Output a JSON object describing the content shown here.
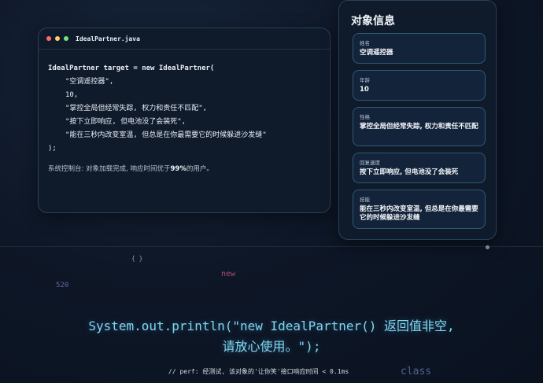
{
  "code_window": {
    "filename": "IdealPartner.java",
    "code_lines": {
      "head": "IdealPartner target = new IdealPartner(",
      "arg1": "\"空调遥控器\",",
      "arg2": "10,",
      "arg3": "\"掌控全局但经常失踪, 权力和责任不匹配\",",
      "arg4": "\"按下立即响应, 但电池没了会装死\",",
      "arg5": "\"能在三秒内改变室温, 但总是在你最需要它的时候躲进沙发缝\"",
      "close": ");"
    },
    "console": {
      "prefix": "系统控制台: 对象加载完成, 响应时间优于",
      "highlight": "99%",
      "suffix": "的用户。"
    }
  },
  "panel": {
    "title": "对象信息",
    "fields": [
      {
        "label": "姓名",
        "value": "空调遥控器"
      },
      {
        "label": "年龄",
        "value": "10"
      },
      {
        "label": "性格",
        "value": "掌控全局但经常失踪, 权力和责任不匹配"
      },
      {
        "label": "回复速度",
        "value": "按下立即响应, 但电池没了会装死"
      },
      {
        "label": "技能",
        "value": "能在三秒内改变室温, 但总是在你最需要它的时候躲进沙发缝"
      }
    ]
  },
  "decorations": {
    "braces": "{ }",
    "num": "520",
    "new_kw": "new",
    "class_kw": "class"
  },
  "statement": "System.out.println(\"new IdealPartner() 返回值非空, 请放心使用。\");",
  "perf_note": "// perf: 经测试, 该对象的'让你笑'接口响应时间 < 0.1ms"
}
